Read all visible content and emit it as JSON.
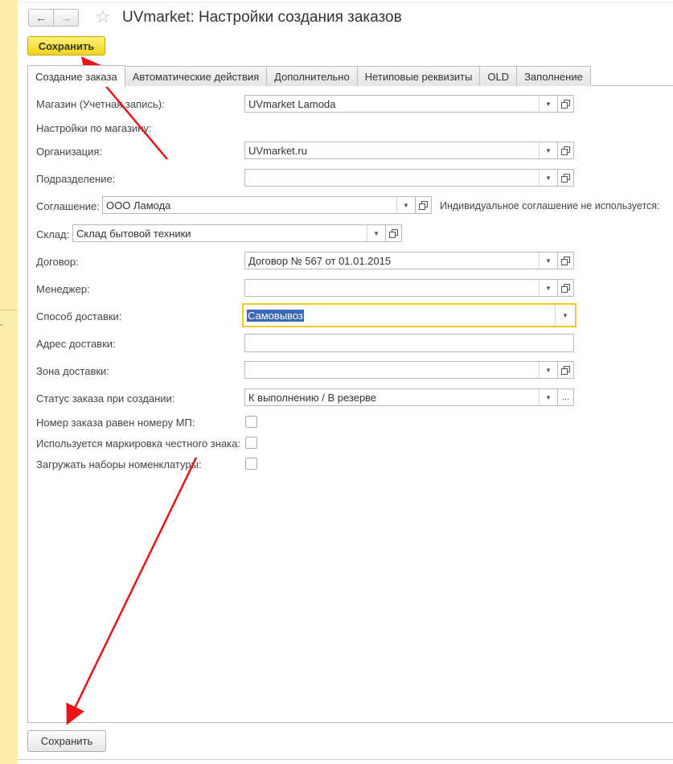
{
  "window": {
    "title": "UVmarket: Настройки создания заказов",
    "nav_back": "←",
    "nav_forward": "→",
    "favorite_star": "☆"
  },
  "toolbar": {
    "save_label": "Сохранить"
  },
  "tabs": [
    {
      "label": "Создание заказа",
      "active": true
    },
    {
      "label": "Автоматические действия"
    },
    {
      "label": "Дополнительно"
    },
    {
      "label": "Нетиповые реквизиты"
    },
    {
      "label": "OLD"
    },
    {
      "label": "Заполнение"
    }
  ],
  "form": {
    "store_label": "Магазин (Учетная запись):",
    "store_value": "UVmarket Lamoda",
    "store_settings_label": "Настройки по магазину:",
    "organization_label": "Организация:",
    "organization_value": "UVmarket.ru",
    "division_label": "Подразделение:",
    "division_value": "",
    "agreement_label": "Соглашение:",
    "agreement_value": "ООО Ламода",
    "individual_agreement_label": "Индивидуальное соглашение не используется:",
    "warehouse_label": "Склад:",
    "warehouse_value": "Склад бытовой техники",
    "contract_label": "Договор:",
    "contract_value": "Договор № 567 от 01.01.2015",
    "manager_label": "Менеджер:",
    "manager_value": "",
    "delivery_method_label": "Способ доставки:",
    "delivery_method_value": "Самовывоз",
    "delivery_address_label": "Адрес доставки:",
    "delivery_address_value": "",
    "delivery_zone_label": "Зона доставки:",
    "delivery_zone_value": "",
    "order_status_label": "Статус заказа при создании:",
    "order_status_value": "К выполнению / В резерве",
    "order_status_choose": "...",
    "order_number_label": "Номер заказа равен номеру МП:",
    "honest_sign_label": "Используется маркировка честного знака:",
    "load_sets_label": "Загружать наборы номенклатуры:"
  },
  "footer": {
    "save_label": "Сохранить"
  },
  "colors": {
    "accent_yellow": "#f0d31a",
    "focus_border": "#f3c623",
    "annotation_arrow": "#e8141a",
    "sidebar": "#fbeeaa",
    "selection": "#3b68b5"
  }
}
